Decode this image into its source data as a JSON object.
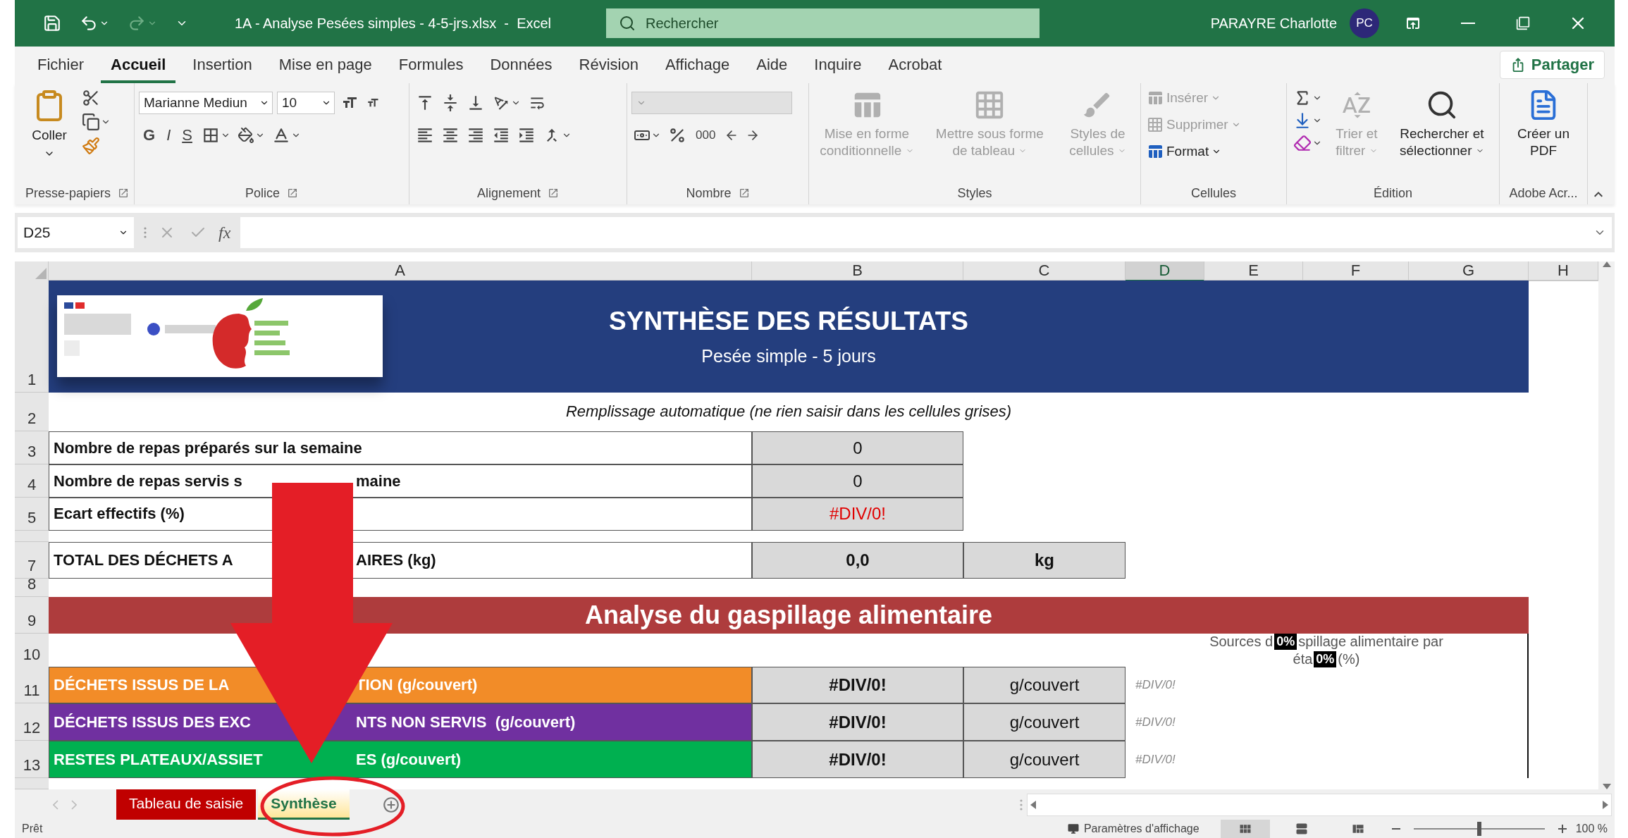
{
  "title_bar": {
    "title": "1A - Analyse Pesées simples - 4-5-jrs.xlsx  -  Excel",
    "search": {
      "placeholder": "Rechercher"
    },
    "user": "PARAYRE Charlotte",
    "avatar": "PC",
    "redo_disabled": true
  },
  "menu_tabs": [
    {
      "label": "Fichier",
      "selected": false
    },
    {
      "label": "Accueil",
      "selected": true
    },
    {
      "label": "Insertion",
      "selected": false
    },
    {
      "label": "Mise en page",
      "selected": false
    },
    {
      "label": "Formules",
      "selected": false
    },
    {
      "label": "Données",
      "selected": false
    },
    {
      "label": "Révision",
      "selected": false
    },
    {
      "label": "Affichage",
      "selected": false
    },
    {
      "label": "Aide",
      "selected": false
    },
    {
      "label": "Inquire",
      "selected": false
    },
    {
      "label": "Acrobat",
      "selected": false
    }
  ],
  "share_button": "Partager",
  "ribbon": {
    "groups": [
      {
        "kind": "clipboard",
        "label": "Presse-papiers",
        "launcher": true,
        "paste": "Coller"
      },
      {
        "kind": "font",
        "label": "Police",
        "launcher": true,
        "font": "Marianne Mediun",
        "size": "10",
        "bold": "G",
        "italic": "I",
        "underline": "S"
      },
      {
        "kind": "alignment",
        "label": "Alignement",
        "launcher": true
      },
      {
        "kind": "number",
        "label": "Nombre",
        "launcher": true,
        "thousands": "000"
      },
      {
        "kind": "styles",
        "label": "Styles",
        "buttons": [
          {
            "label": "Mise en forme conditionnelle",
            "disabled": true
          },
          {
            "label": "Mettre sous forme de tableau",
            "disabled": true
          },
          {
            "label": "Styles de cellules",
            "disabled": true
          }
        ]
      },
      {
        "kind": "cells",
        "label": "Cellules",
        "buttons": [
          {
            "label": "Insérer",
            "disabled": true
          },
          {
            "label": "Supprimer",
            "disabled": true
          },
          {
            "label": "Format",
            "disabled": false
          }
        ]
      },
      {
        "kind": "editing",
        "label": "Édition",
        "buttons": [
          {
            "label": "Trier et filtrer",
            "disabled": true
          },
          {
            "label": "Rechercher et sélectionner",
            "disabled": false
          }
        ]
      },
      {
        "kind": "adobe",
        "label": "Adobe Acr...",
        "button": "Créer un PDF"
      }
    ]
  },
  "formula_bar": {
    "name_box": "D25",
    "function_label": "fx"
  },
  "sheet": {
    "columns": [
      {
        "label": "A",
        "selected": false
      },
      {
        "label": "B",
        "selected": false
      },
      {
        "label": "C",
        "selected": false
      },
      {
        "label": "D",
        "selected": true
      },
      {
        "label": "E",
        "selected": false
      },
      {
        "label": "F",
        "selected": false
      },
      {
        "label": "G",
        "selected": false
      },
      {
        "label": "H",
        "selected": false
      }
    ],
    "rows": [
      {
        "kind": "banner",
        "number": "1",
        "title": "SYNTHÈSE DES RÉSULTATS",
        "subtitle": "Pesée simple - 5 jours"
      },
      {
        "kind": "note",
        "number": "2",
        "text": "Remplissage automatique (ne rien saisir dans les cellules grises)"
      },
      {
        "kind": "metric",
        "number": "3",
        "label": [
          "Nombre de repas préparés sur la semaine"
        ],
        "value": "0",
        "error": false
      },
      {
        "kind": "metric",
        "number": "4",
        "label": [
          "Nombre de repas servis s",
          "maine"
        ],
        "value": "0",
        "error": false
      },
      {
        "kind": "metric",
        "number": "5",
        "label": [
          "Ecart effectifs (%)"
        ],
        "value": "#DIV/0!",
        "error": true
      },
      {
        "kind": "gap"
      },
      {
        "kind": "total",
        "number": "7",
        "label": [
          "TOTAL DES DÉCHETS A",
          "AIRES (kg)"
        ],
        "value": "0,0",
        "unit": "kg"
      },
      {
        "kind": "blank",
        "number": "8"
      },
      {
        "kind": "section",
        "number": "9",
        "text": "Analyse du gaspillage alimentaire"
      },
      {
        "kind": "chart_title",
        "number": "10",
        "line_1": [
          "Sources d",
          "spillage alimentaire par"
        ],
        "line_2": [
          "éta",
          "(%)"
        ],
        "data_labels": [
          "0%",
          "0%"
        ]
      },
      {
        "kind": "waste",
        "number": "11",
        "label": [
          "DÉCHETS ISSUS DE LA",
          "TION (g/couvert)"
        ],
        "color": "#f28c28",
        "value": "#DIV/0!",
        "unit": "g/couvert",
        "share": "#DIV/0!"
      },
      {
        "kind": "waste",
        "number": "12",
        "label": [
          "DÉCHETS ISSUS DES EXC",
          "NTS NON SERVIS  (g/couvert)"
        ],
        "color": "#7030a0",
        "value": "#DIV/0!",
        "unit": "g/couvert",
        "share": "#DIV/0!"
      },
      {
        "kind": "waste",
        "number": "13",
        "label": [
          "RESTES PLATEAUX/ASSIET",
          "ES (g/couvert)"
        ],
        "color": "#00b050",
        "value": "#DIV/0!",
        "unit": "g/couvert",
        "share": "#DIV/0!"
      },
      {
        "kind": "gap"
      }
    ]
  },
  "sheet_tabs": [
    {
      "label": "Tableau de saisie",
      "selected": false,
      "color": "#c00000"
    },
    {
      "label": "Synthèse",
      "selected": true,
      "color": "#ffe699"
    }
  ],
  "status_bar": {
    "status": "Prêt",
    "display_settings": "Paramètres d'affichage",
    "views": [
      {
        "kind": "normal",
        "selected": true
      },
      {
        "kind": "page_layout",
        "selected": false
      },
      {
        "kind": "page_break",
        "selected": false
      }
    ],
    "zoom": {
      "level": 0.5,
      "reading": "100 %"
    }
  }
}
